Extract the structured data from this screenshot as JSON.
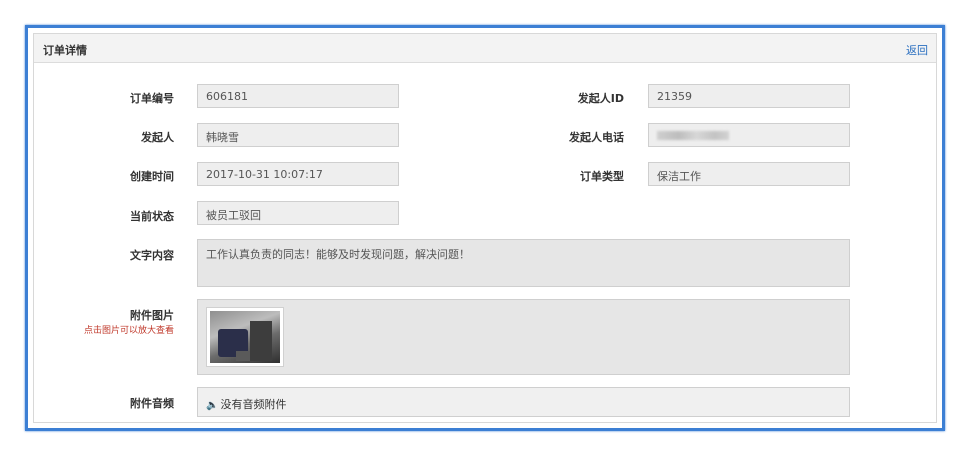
{
  "header": {
    "title": "订单详情",
    "back_label": "返回"
  },
  "fields": {
    "order_no": {
      "label": "订单编号",
      "value": "606181"
    },
    "initiator_id": {
      "label": "发起人ID",
      "value": "21359"
    },
    "initiator": {
      "label": "发起人",
      "value": "韩晓雪"
    },
    "phone": {
      "label": "发起人电话",
      "value": ""
    },
    "created": {
      "label": "创建时间",
      "value": "2017-10-31 10:07:17"
    },
    "order_type": {
      "label": "订单类型",
      "value": "保洁工作"
    },
    "status": {
      "label": "当前状态",
      "value": "被员工驳回"
    },
    "content": {
      "label": "文字内容",
      "value": "工作认真负责的同志！能够及时发现问题，解决问题！"
    }
  },
  "attachment_image": {
    "label": "附件图片",
    "hint": "点击图片可以放大查看"
  },
  "attachment_audio": {
    "label": "附件音频",
    "value": "没有音频附件",
    "icon": "speaker-icon"
  }
}
